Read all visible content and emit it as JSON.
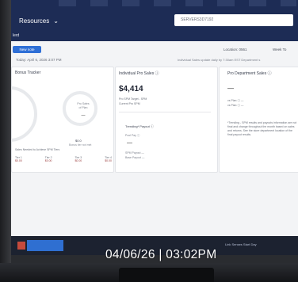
{
  "header": {
    "nav_title": "Resources",
    "nav_chevron": "chevron-down-icon",
    "search_value": "SERVERS3D7192",
    "sub_title": "lerd"
  },
  "toolbar": {
    "new_button_label": "New note",
    "location_label": "Location: 0561",
    "week_label": "Week To",
    "date_line": "Today: April 6, 2026 3:07 PM",
    "sync_note": "Individual Sales update daily by 7:30am EST  Department s"
  },
  "bonus_card": {
    "title": "Bonus Tracker",
    "ring_label": "Pro Sales",
    "ring_sub": "of Plan",
    "ring_value": "—",
    "amount": "$0.0",
    "sub": "Bonus tier not met",
    "footnote": "Sales Needed to Achieve SPM Tiers",
    "tiers": [
      {
        "label": "Tier 1",
        "value": "$0.00"
      },
      {
        "label": "Tier 2",
        "value": "$0.00"
      },
      {
        "label": "Tier 3",
        "value": "$0.00"
      },
      {
        "label": "Tier 4",
        "value": "$0.00"
      }
    ]
  },
  "individual_card": {
    "title": "Individual Pro Sales ⓘ",
    "amount": "$4,414",
    "line1": "Pro SPM Target - SPM",
    "line2": "Current Pro SPM",
    "trending_title": "Trending* Payout ⓘ",
    "trend_line1": "Pool Pay ⓘ",
    "trend_dash": "—",
    "trend_line2": "SPM Payout —",
    "trend_line3": "Base Payout —"
  },
  "pro_card": {
    "title": "Pro Department Sales ⓘ",
    "dash": "—",
    "line1": "vs Plan ⓘ —",
    "line2": "vs Plan ⓘ —",
    "note": "*Trending - SPM results and payouts information are not final and change throughout the month based on sales and returns. See the store department location of the final payout results."
  },
  "taskbar": {
    "app_label": "",
    "tray_text": "Link Senses   Start Day"
  },
  "overlay": {
    "timestamp": "04/06/26 | 03:02PM"
  },
  "colors": {
    "header_navy": "#1d2c55",
    "primary_blue": "#2e6fd6",
    "taskbar": "#1c2230"
  }
}
